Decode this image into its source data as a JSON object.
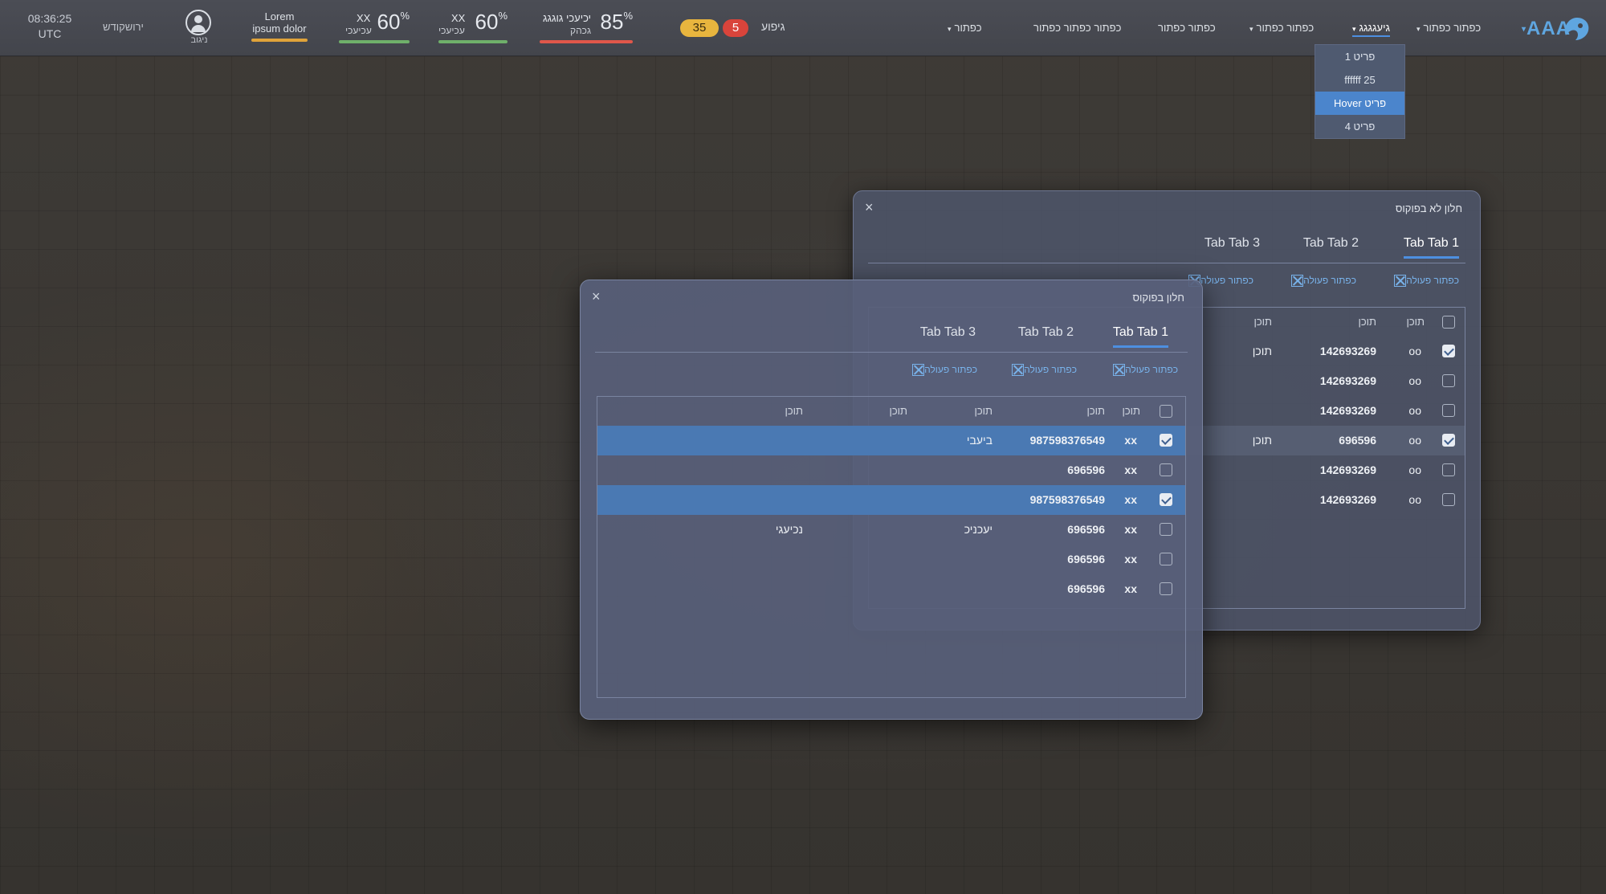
{
  "topbar": {
    "time": "08:36:25",
    "timezone": "UTC",
    "user_name": "ירושקודש",
    "avatar_label": "ניגוב",
    "lorem_line1": "Lorem",
    "lorem_line2": "ipsum dolor",
    "stats": [
      {
        "pct": "60",
        "unit": "%",
        "line1": "XX",
        "line2": "עכיעכי",
        "color": "#6fb06a"
      },
      {
        "pct": "60",
        "unit": "%",
        "line1": "XX",
        "line2": "עכיעכי",
        "color": "#6fb06a"
      },
      {
        "pct": "85",
        "unit": "%",
        "line1": "יכיעכי גוגגג",
        "line2": "גכהק",
        "color": "#e0574a"
      }
    ],
    "pill_yellow": "35",
    "pill_red": "5",
    "notif_label": "גיפוע",
    "nav": [
      {
        "label": "כפתור",
        "caret": "▾"
      },
      {
        "label": "כפתור כפתור כפתור",
        "caret": ""
      },
      {
        "label": "כפתור כפתור",
        "caret": ""
      },
      {
        "label": "כפתור כפתור",
        "caret": "▾"
      },
      {
        "label": "גיעגגגג",
        "caret": "▾"
      },
      {
        "label": "כפתור כפתור",
        "caret": "▾"
      }
    ],
    "logo": "AAA",
    "logo_caret": "▾"
  },
  "dropdown": {
    "items": [
      "פריט 1",
      "ffffff 25",
      "Hover פריט",
      "פריט 4"
    ]
  },
  "window_back": {
    "title": "חלון לא בפוקוס",
    "close": "×",
    "tabs": [
      "Tab Tab 1",
      "Tab Tab 2",
      "Tab Tab 3"
    ],
    "actions": [
      "כפתור פעולה",
      "כפתור פעולה",
      "כפתור פעולה"
    ],
    "headers": [
      "תוכן",
      "תוכן",
      "תוכן"
    ],
    "rows": [
      {
        "checked": true,
        "c1": "oo",
        "c2": "142693269",
        "c3": "תוכן"
      },
      {
        "checked": false,
        "c1": "oo",
        "c2": "142693269",
        "c3": ""
      },
      {
        "checked": false,
        "c1": "oo",
        "c2": "142693269",
        "c3": ""
      },
      {
        "checked": true,
        "c1": "oo",
        "c2": "696596",
        "c3": "תוכן"
      },
      {
        "checked": false,
        "c1": "oo",
        "c2": "142693269",
        "c3": ""
      },
      {
        "checked": false,
        "c1": "oo",
        "c2": "142693269",
        "c3": ""
      }
    ]
  },
  "window_front": {
    "title": "חלון בפוקוס",
    "close": "×",
    "tabs": [
      "Tab Tab 1",
      "Tab Tab 2",
      "Tab Tab 3"
    ],
    "actions": [
      "כפתור פעולה",
      "כפתור פעולה",
      "כפתור פעולה"
    ],
    "headers": [
      "תוכן",
      "תוכן",
      "תוכן",
      "תוכן",
      "תוכן"
    ],
    "rows": [
      {
        "checked": true,
        "c1": "xx",
        "c2": "987598376549",
        "c3": "ביעבי",
        "c4": "",
        "c5": ""
      },
      {
        "checked": false,
        "c1": "xx",
        "c2": "696596",
        "c3": "",
        "c4": "",
        "c5": ""
      },
      {
        "checked": true,
        "c1": "xx",
        "c2": "987598376549",
        "c3": "",
        "c4": "",
        "c5": ""
      },
      {
        "checked": false,
        "c1": "xx",
        "c2": "696596",
        "c3": "יעכניכ",
        "c4": "",
        "c5": "נכיעגי"
      },
      {
        "checked": false,
        "c1": "xx",
        "c2": "696596",
        "c3": "",
        "c4": "",
        "c5": ""
      },
      {
        "checked": false,
        "c1": "xx",
        "c2": "696596",
        "c3": "",
        "c4": "",
        "c5": ""
      }
    ]
  }
}
